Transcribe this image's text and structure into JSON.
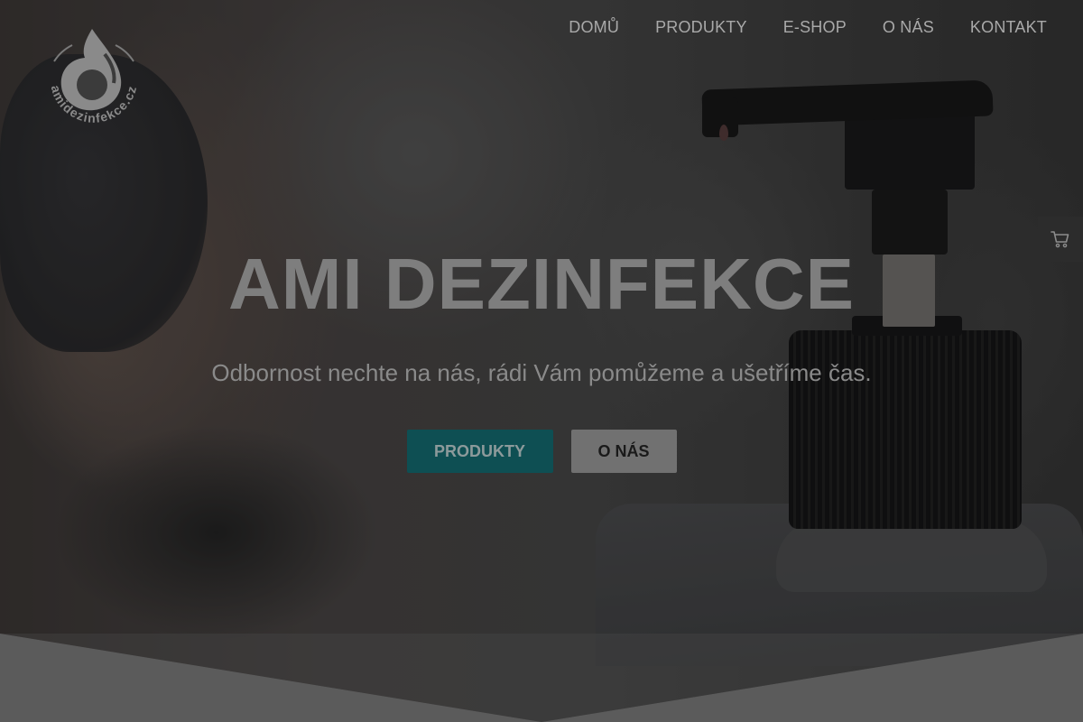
{
  "brand": {
    "logo_text": "amidezinfekce.cz"
  },
  "nav": {
    "items": [
      {
        "label": "DOMŮ"
      },
      {
        "label": "PRODUKTY"
      },
      {
        "label": "E-SHOP"
      },
      {
        "label": "O NÁS"
      },
      {
        "label": "KONTAKT"
      }
    ]
  },
  "cart": {
    "icon": "shopping-cart-icon"
  },
  "hero": {
    "title": "AMI DEZINFEKCE",
    "subtitle": "Odbornost nechte na nás, rádi Vám pomůžeme a ušetříme čas.",
    "primary_button": "PRODUKTY",
    "secondary_button": "O NÁS"
  },
  "colors": {
    "primary_button_bg": "#0e4f53",
    "secondary_button_bg": "#717171",
    "overlay": "#141414",
    "bottom_section": "#5b5b5b"
  }
}
